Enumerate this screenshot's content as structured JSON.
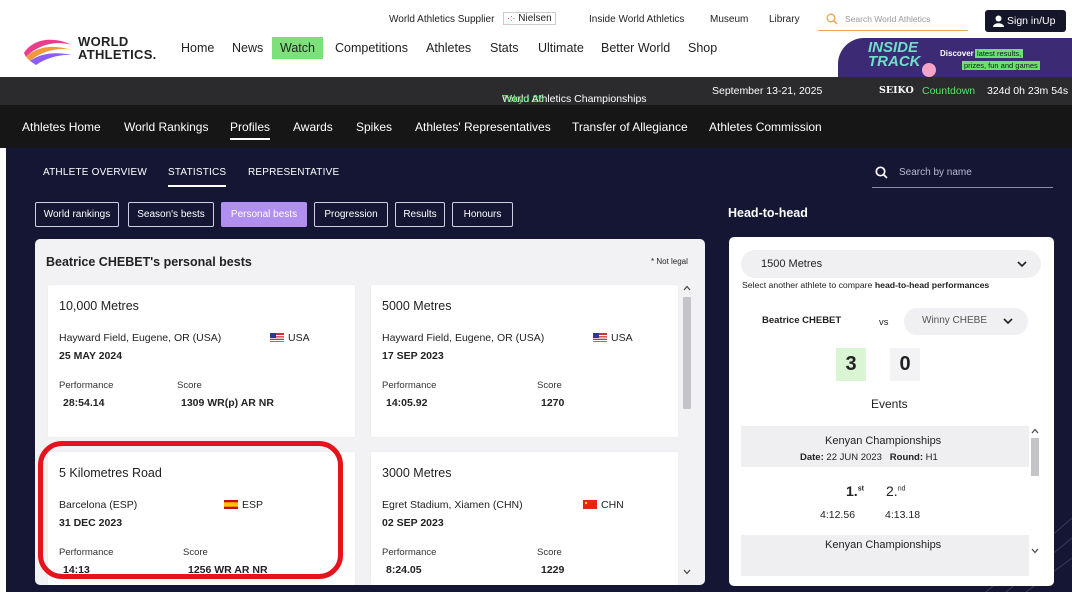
{
  "topnav": {
    "supplier": "World Athletics Supplier",
    "nielsen": "Nielsen",
    "inside": "Inside World Athletics",
    "museum": "Museum",
    "library": "Library",
    "search_placeholder": "Search World Athletics",
    "signin": "Sign in/Up"
  },
  "logo": {
    "line1": "WORLD",
    "line2": "ATHLETICS."
  },
  "mainnav": [
    "Home",
    "News",
    "Watch",
    "Competitions",
    "Athletes",
    "Stats",
    "Ultimate",
    "Better World",
    "Shop"
  ],
  "promo": {
    "title1": "INSIDE",
    "title2": "TRACK",
    "discover": "Discover",
    "tag1": "latest results,",
    "tag2": "prizes, fun and games"
  },
  "champ_bar": {
    "name": "World Athletics Championships",
    "city": "Tokyo 25",
    "dates": "September 13-21, 2025",
    "sponsor": "SEIKO",
    "countdown_label": "Countdown",
    "countdown": "324d 0h 23m 54s"
  },
  "subnav": [
    "Athletes Home",
    "World Rankings",
    "Profiles",
    "Awards",
    "Spikes",
    "Athletes' Representatives",
    "Transfer of Allegiance",
    "Athletes Commission"
  ],
  "profile_tabs": [
    "ATHLETE OVERVIEW",
    "STATISTICS",
    "REPRESENTATIVE"
  ],
  "search_name_placeholder": "Search by name",
  "stat_pills": [
    "World rankings",
    "Season's bests",
    "Personal bests",
    "Progression",
    "Results",
    "Honours"
  ],
  "pb": {
    "title": "Beatrice CHEBET's personal bests",
    "note": "* Not legal",
    "perf_label": "Performance",
    "score_label": "Score",
    "cards": [
      {
        "event": "10,000 Metres",
        "venue": "Hayward Field, Eugene, OR (USA)",
        "country": "USA",
        "date": "25 MAY 2024",
        "performance": "28:54.14",
        "score": "1309 WR(p) AR NR"
      },
      {
        "event": "5000 Metres",
        "venue": "Hayward Field, Eugene, OR (USA)",
        "country": "USA",
        "date": "17 SEP 2023",
        "performance": "14:05.92",
        "score": "1270"
      },
      {
        "event": "5 Kilometres Road",
        "venue": "Barcelona (ESP)",
        "country": "ESP",
        "date": "31 DEC 2023",
        "performance": "14:13",
        "score": "1256 WR AR NR"
      },
      {
        "event": "3000 Metres",
        "venue": "Egret Stadium, Xiamen (CHN)",
        "country": "CHN",
        "date": "02 SEP 2023",
        "performance": "8:24.05",
        "score": "1229"
      }
    ]
  },
  "h2h": {
    "title": "Head-to-head",
    "event_select": "1500 Metres",
    "instruction_plain": "Select another athlete to compare",
    "instruction_bold": "head-to-head performances",
    "athlete1": "Beatrice CHEBET",
    "vs": "vs",
    "athlete2": "Winny CHEBE",
    "score1": "3",
    "score2": "0",
    "events_label": "Events",
    "meets": [
      {
        "name": "Kenyan Championships",
        "date_label": "Date:",
        "date": "22 JUN 2023",
        "round_label": "Round:",
        "round": "H1",
        "place1": "1.",
        "sup1": "st",
        "place2": "2.",
        "sup2": "nd",
        "time1": "4:12.56",
        "time2": "4:13.18"
      },
      {
        "name": "Kenyan Championships"
      }
    ]
  },
  "colors": {
    "accent_green": "#7de07a",
    "pill_active": "#b18ff0",
    "highlight_red": "#e6121c",
    "main_bg": "#151634"
  }
}
